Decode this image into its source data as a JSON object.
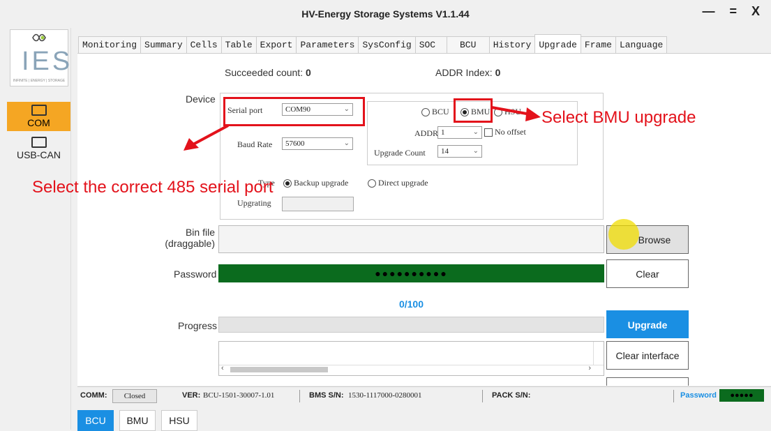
{
  "window": {
    "title": "HV-Energy Storage Systems V1.1.44",
    "controls": "— = X"
  },
  "sidebar": {
    "logo_text": "IES",
    "logo_tagline": "INFINITE | ENERGY | STORAGE",
    "items": [
      {
        "label": "COM",
        "active": true
      },
      {
        "label": "USB-CAN",
        "active": false
      }
    ]
  },
  "tabs": [
    "Monitoring",
    "Summary",
    "Cells",
    "Table",
    "Export",
    "Parameters",
    "SysConfig",
    "SOC",
    "BCU",
    "History",
    "Upgrade",
    "Frame",
    "Language"
  ],
  "active_tab": "Upgrade",
  "upgrade": {
    "succeeded_label": "Succeeded count:",
    "succeeded_value": "0",
    "addr_index_label": "ADDR Index:",
    "addr_index_value": "0",
    "device_label": "Device",
    "serial_port_label": "Serial port",
    "serial_port_value": "COM90",
    "baud_rate_label": "Baud Rate",
    "baud_rate_value": "57600",
    "target_options": [
      "BCU",
      "BMU",
      "HSU"
    ],
    "target_selected": "BMU",
    "addr_label": "ADDR",
    "addr_value": "1",
    "no_offset_label": "No offset",
    "upgrade_count_label": "Upgrade Count",
    "upgrade_count_value": "14",
    "type_label": "Type",
    "type_options": [
      "Backup upgrade",
      "Direct upgrade"
    ],
    "type_selected": "Backup upgrade",
    "upgrating_label": "Upgrating",
    "bin_file_label_1": "Bin file",
    "bin_file_label_2": "(draggable)",
    "browse_button": "Browse",
    "password_label": "Password",
    "password_mask": "●●●●●●●●●●",
    "clear_button": "Clear",
    "progress_text": "0/100",
    "progress_label": "Progress",
    "progress_fraction": 0.0,
    "upgrade_button": "Upgrade",
    "clear_interface_button": "Clear interface"
  },
  "annotations": {
    "bmu": "Select BMU upgrade",
    "serial": "Select the correct 485 serial port"
  },
  "status": {
    "comm_label": "COMM:",
    "comm_value": "Closed",
    "ver_label": "VER:",
    "ver_value": "BCU-1501-30007-1.01",
    "bms_label": "BMS S/N:",
    "bms_value": "1530-1117000-0280001",
    "pack_label": "PACK S/N:",
    "password_label": "Password",
    "password_mask": "●●●●●"
  },
  "bottom_tabs": [
    {
      "label": "BCU",
      "active": true
    },
    {
      "label": "BMU",
      "active": false
    },
    {
      "label": "HSU",
      "active": false
    }
  ],
  "colors": {
    "accent": "#1a8fe3",
    "active_com": "#f5a623",
    "password_bg": "#0b6b1e",
    "annotation": "#e3121b"
  }
}
